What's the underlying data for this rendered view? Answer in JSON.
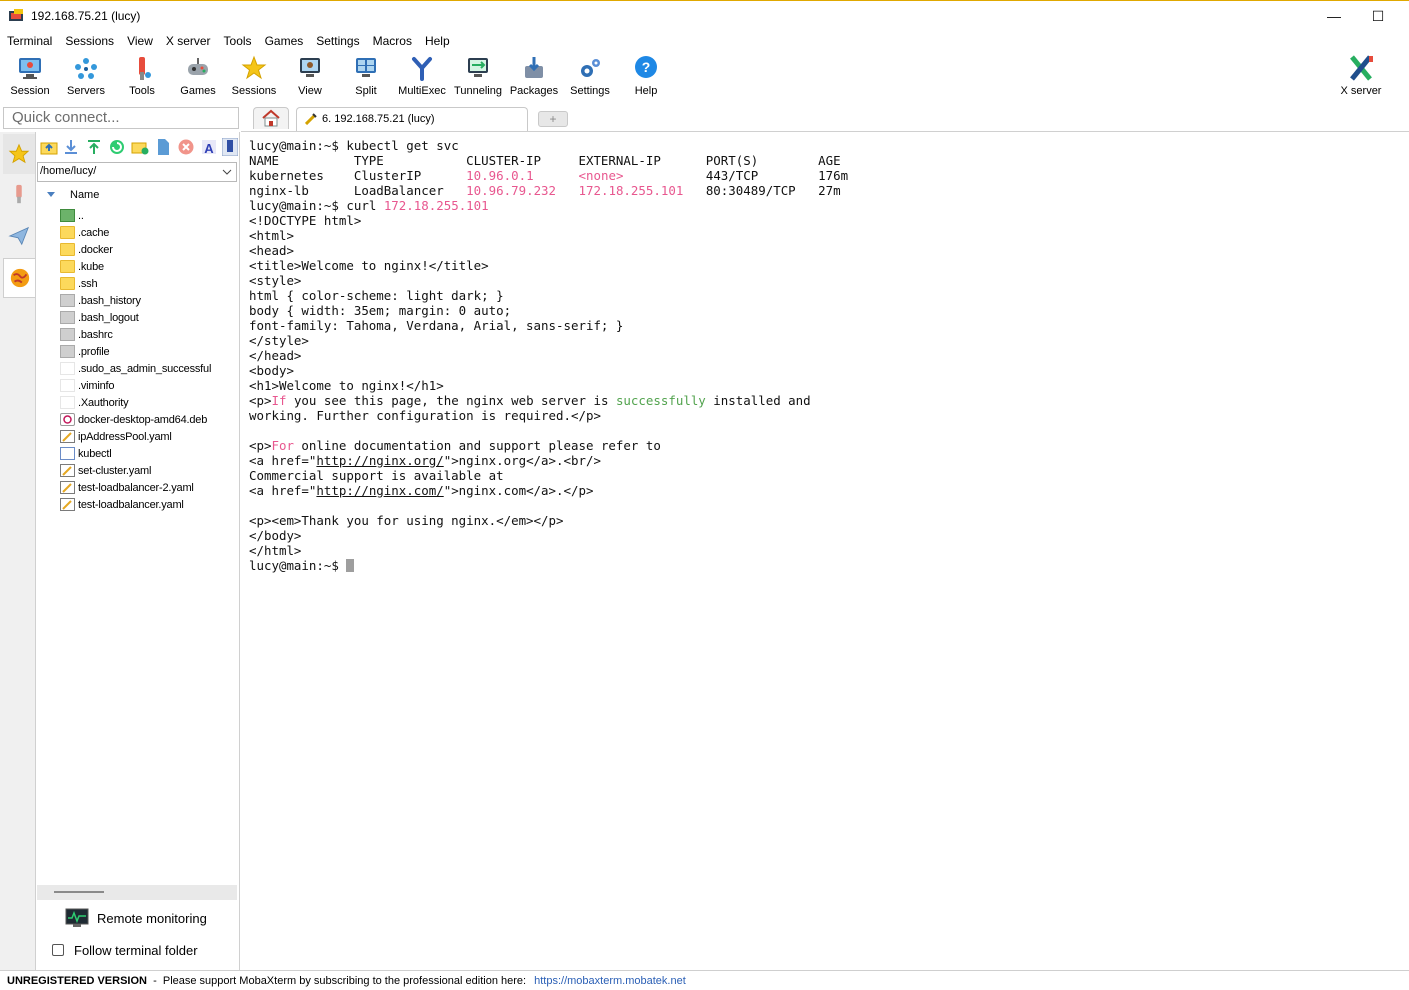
{
  "window": {
    "title": "192.168.75.21 (lucy)",
    "minimize": "—",
    "maximize": "☐"
  },
  "menu": [
    "Terminal",
    "Sessions",
    "View",
    "X server",
    "Tools",
    "Games",
    "Settings",
    "Macros",
    "Help"
  ],
  "toolbar": {
    "session": "Session",
    "servers": "Servers",
    "tools": "Tools",
    "games": "Games",
    "sessions": "Sessions",
    "view": "View",
    "split": "Split",
    "multiexec": "MultiExec",
    "tunneling": "Tunneling",
    "packages": "Packages",
    "settings": "Settings",
    "help": "Help",
    "xserver": "X server"
  },
  "quick_connect": {
    "placeholder": "Quick connect..."
  },
  "tabs": {
    "session_tab": "6. 192.168.75.21 (lucy)",
    "add_tab": "+"
  },
  "file_panel": {
    "path": "/home/lucy/",
    "column_name": "Name",
    "files": [
      {
        "name": "..",
        "icon": "up"
      },
      {
        "name": ".cache",
        "icon": "folder"
      },
      {
        "name": ".docker",
        "icon": "folder"
      },
      {
        "name": ".kube",
        "icon": "folder"
      },
      {
        "name": ".ssh",
        "icon": "folder"
      },
      {
        "name": ".bash_history",
        "icon": "hidden"
      },
      {
        "name": ".bash_logout",
        "icon": "hidden"
      },
      {
        "name": ".bashrc",
        "icon": "hidden"
      },
      {
        "name": ".profile",
        "icon": "hidden"
      },
      {
        "name": ".sudo_as_admin_successful",
        "icon": "blank"
      },
      {
        "name": ".viminfo",
        "icon": "blank"
      },
      {
        "name": ".Xauthority",
        "icon": "blank"
      },
      {
        "name": "docker-desktop-amd64.deb",
        "icon": "deb"
      },
      {
        "name": "ipAddressPool.yaml",
        "icon": "yaml"
      },
      {
        "name": "kubectl",
        "icon": "kube"
      },
      {
        "name": "set-cluster.yaml",
        "icon": "yaml"
      },
      {
        "name": "test-loadbalancer-2.yaml",
        "icon": "yaml"
      },
      {
        "name": "test-loadbalancer.yaml",
        "icon": "yaml"
      }
    ],
    "remote_monitoring": "Remote monitoring",
    "follow_terminal_folder": "Follow terminal folder",
    "follow_checked": false
  },
  "terminal": {
    "prompt": "lucy@main:~$ ",
    "cmd1": "kubectl get svc",
    "table_header": "NAME          TYPE           CLUSTER-IP     EXTERNAL-IP      PORT(S)        AGE",
    "row1": {
      "name": "kubernetes    ",
      "type": "ClusterIP      ",
      "cluster_ip": "10.96.0.1",
      "pad1": "      ",
      "external_ip": "<none>",
      "pad2": "           ",
      "ports": "443/TCP        ",
      "age": "176m"
    },
    "row2": {
      "name": "nginx-lb      ",
      "type": "LoadBalancer   ",
      "cluster_ip": "10.96.79.232",
      "pad1": "   ",
      "external_ip": "172.18.255.101",
      "pad2": "   ",
      "ports": "80:30489/TCP   ",
      "age": "27m"
    },
    "cmd2": "curl ",
    "cmd2_ip": "172.18.255.101",
    "html_lines": [
      "<!DOCTYPE html>",
      "<html>",
      "<head>",
      "<title>Welcome to nginx!</title>",
      "<style>",
      "html { color-scheme: light dark; }",
      "body { width: 35em; margin: 0 auto;",
      "font-family: Tahoma, Verdana, Arial, sans-serif; }",
      "</style>",
      "</head>",
      "<body>",
      "<h1>Welcome to nginx!</h1>"
    ],
    "p1_open": "<p>",
    "p1_if": "If",
    "p1_mid": " you see this page, the nginx web server is ",
    "p1_succ": "successfully",
    "p1_end": " installed and",
    "p1_line2": "working. Further configuration is required.</p>",
    "p2_open": "<p>",
    "p2_for": "For",
    "p2_end": " online documentation and support please refer to",
    "a1_pre": "<a href=\"",
    "a1_url": "http://nginx.org/",
    "a1_post": "\">nginx.org</a>.<br/>",
    "commercial": "Commercial support is available at",
    "a2_pre": "<a href=\"",
    "a2_url": "http://nginx.com/",
    "a2_post": "\">nginx.com</a>.</p>",
    "thanks": "<p><em>Thank you for using nginx.</em></p>",
    "end_body": "</body>",
    "end_html": "</html>"
  },
  "status_bar": {
    "unregistered": "UNREGISTERED VERSION",
    "message": "  -  Please support MobaXterm by subscribing to the professional edition here: ",
    "link": "https://mobaxterm.mobatek.net"
  },
  "colors": {
    "highlight_pink": "#e8578f",
    "highlight_green": "#52a34e",
    "link_blue": "#2a5fb5"
  }
}
